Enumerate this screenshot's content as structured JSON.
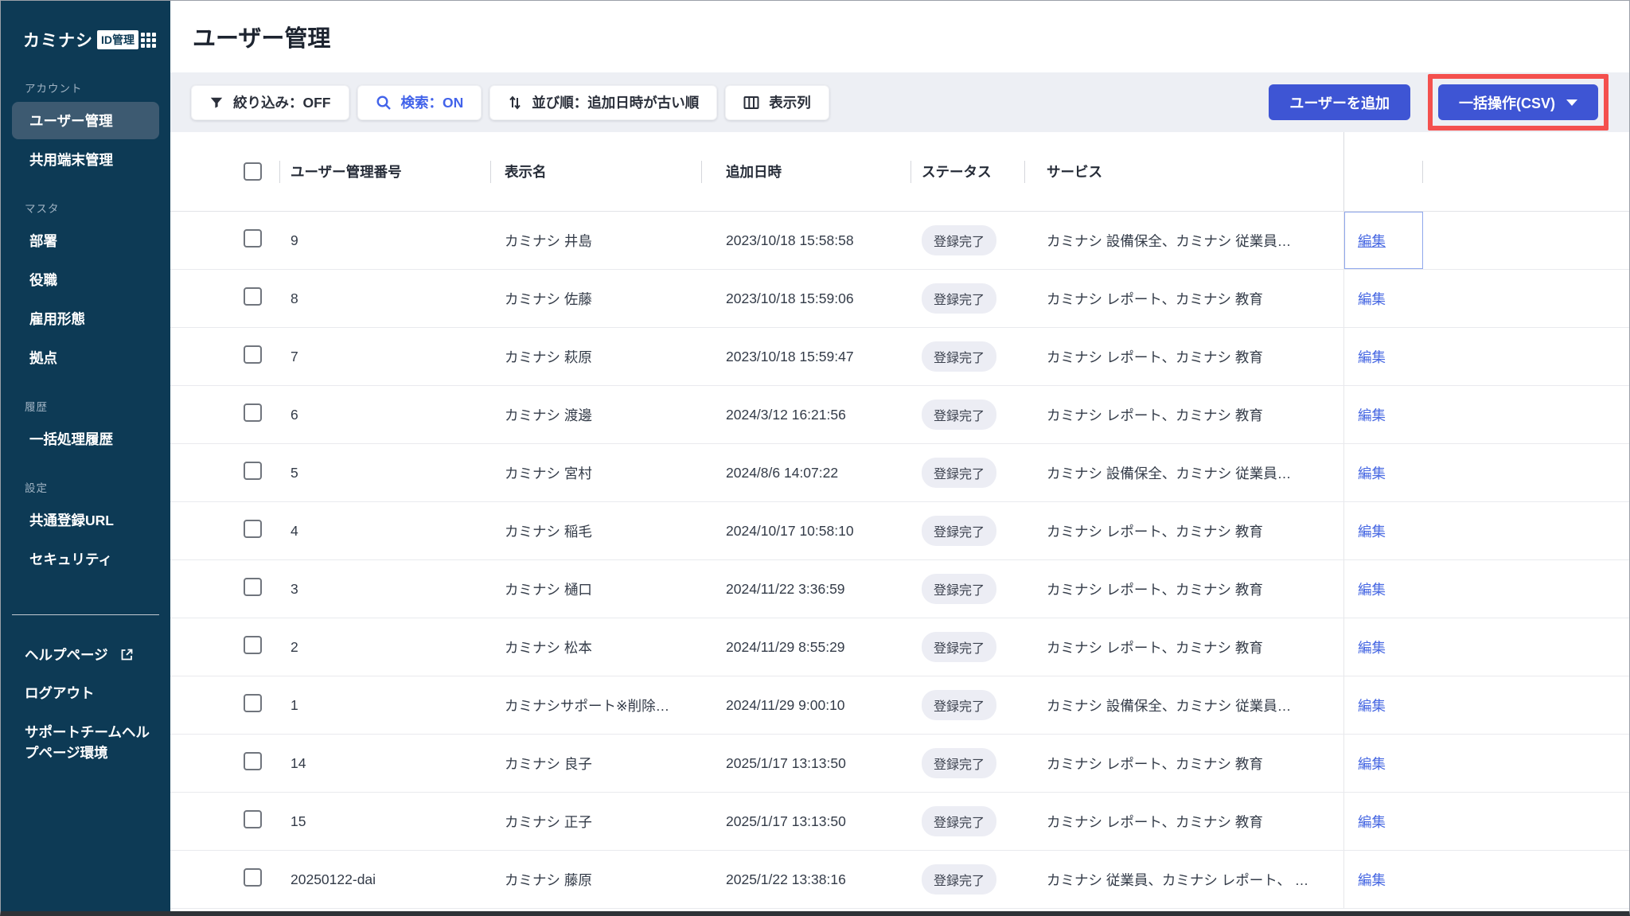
{
  "sidebar": {
    "logo_brand": "カミナシ",
    "logo_badge": "ID管理",
    "sections": [
      {
        "label": "アカウント",
        "items": [
          {
            "label": "ユーザー管理",
            "active": true
          },
          {
            "label": "共用端末管理",
            "active": false
          }
        ]
      },
      {
        "label": "マスタ",
        "items": [
          {
            "label": "部署"
          },
          {
            "label": "役職"
          },
          {
            "label": "雇用形態"
          },
          {
            "label": "拠点"
          }
        ]
      },
      {
        "label": "履歴",
        "items": [
          {
            "label": "一括処理履歴"
          }
        ]
      },
      {
        "label": "設定",
        "items": [
          {
            "label": "共通登録URL"
          },
          {
            "label": "セキュリティ"
          }
        ]
      }
    ],
    "footer_items": [
      {
        "label": "ヘルプページ",
        "external": true
      },
      {
        "label": "ログアウト",
        "external": false
      },
      {
        "label": "サポートチームヘルプページ環境",
        "external": false
      }
    ]
  },
  "header": {
    "title": "ユーザー管理"
  },
  "toolbar": {
    "filter_label": "絞り込み：OFF",
    "search_label": "検索：ON",
    "sort_label": "並び順：追加日時が古い順",
    "columns_label": "表示列",
    "add_user_label": "ユーザーを追加",
    "bulk_label": "一括操作(CSV)"
  },
  "table": {
    "headers": [
      "ユーザー管理番号",
      "表示名",
      "追加日時",
      "ステータス",
      "サービス"
    ],
    "edit_label": "編集",
    "rows": [
      {
        "id": "9",
        "name": "カミナシ 井島",
        "added": "2023/10/18 15:58:58",
        "status": "登録完了",
        "services": "カミナシ 設備保全、カミナシ 従業員…",
        "edit_focused": true
      },
      {
        "id": "8",
        "name": "カミナシ 佐藤",
        "added": "2023/10/18 15:59:06",
        "status": "登録完了",
        "services": "カミナシ レポート、カミナシ 教育",
        "edit_focused": false
      },
      {
        "id": "7",
        "name": "カミナシ 萩原",
        "added": "2023/10/18 15:59:47",
        "status": "登録完了",
        "services": "カミナシ レポート、カミナシ 教育",
        "edit_focused": false
      },
      {
        "id": "6",
        "name": "カミナシ 渡邊",
        "added": "2024/3/12 16:21:56",
        "status": "登録完了",
        "services": "カミナシ レポート、カミナシ 教育",
        "edit_focused": false
      },
      {
        "id": "5",
        "name": "カミナシ 宮村",
        "added": "2024/8/6 14:07:22",
        "status": "登録完了",
        "services": "カミナシ 設備保全、カミナシ 従業員…",
        "edit_focused": false
      },
      {
        "id": "4",
        "name": "カミナシ 稲毛",
        "added": "2024/10/17 10:58:10",
        "status": "登録完了",
        "services": "カミナシ レポート、カミナシ 教育",
        "edit_focused": false
      },
      {
        "id": "3",
        "name": "カミナシ 樋口",
        "added": "2024/11/22 3:36:59",
        "status": "登録完了",
        "services": "カミナシ レポート、カミナシ 教育",
        "edit_focused": false
      },
      {
        "id": "2",
        "name": "カミナシ 松本",
        "added": "2024/11/29 8:55:29",
        "status": "登録完了",
        "services": "カミナシ レポート、カミナシ 教育",
        "edit_focused": false
      },
      {
        "id": "1",
        "name": "カミナシサポート※削除…",
        "added": "2024/11/29 9:00:10",
        "status": "登録完了",
        "services": "カミナシ 設備保全、カミナシ 従業員…",
        "edit_focused": false
      },
      {
        "id": "14",
        "name": "カミナシ 良子",
        "added": "2025/1/17 13:13:50",
        "status": "登録完了",
        "services": "カミナシ レポート、カミナシ 教育",
        "edit_focused": false
      },
      {
        "id": "15",
        "name": "カミナシ 正子",
        "added": "2025/1/17 13:13:50",
        "status": "登録完了",
        "services": "カミナシ レポート、カミナシ 教育",
        "edit_focused": false
      },
      {
        "id": "20250122-dai",
        "name": "カミナシ 藤原",
        "added": "2025/1/22 13:38:16",
        "status": "登録完了",
        "services": "カミナシ 従業員、カミナシ レポート、 …",
        "edit_focused": false
      }
    ]
  },
  "colors": {
    "sidebar_bg": "#0d3a55",
    "sidebar_active_bg": "#3d5a71",
    "accent_blue": "#3e55d4",
    "link_blue": "#4667e2",
    "annotation_red": "#f4504e",
    "badge_bg": "#ecedf4",
    "toolbar_band_bg": "#edeff4"
  }
}
